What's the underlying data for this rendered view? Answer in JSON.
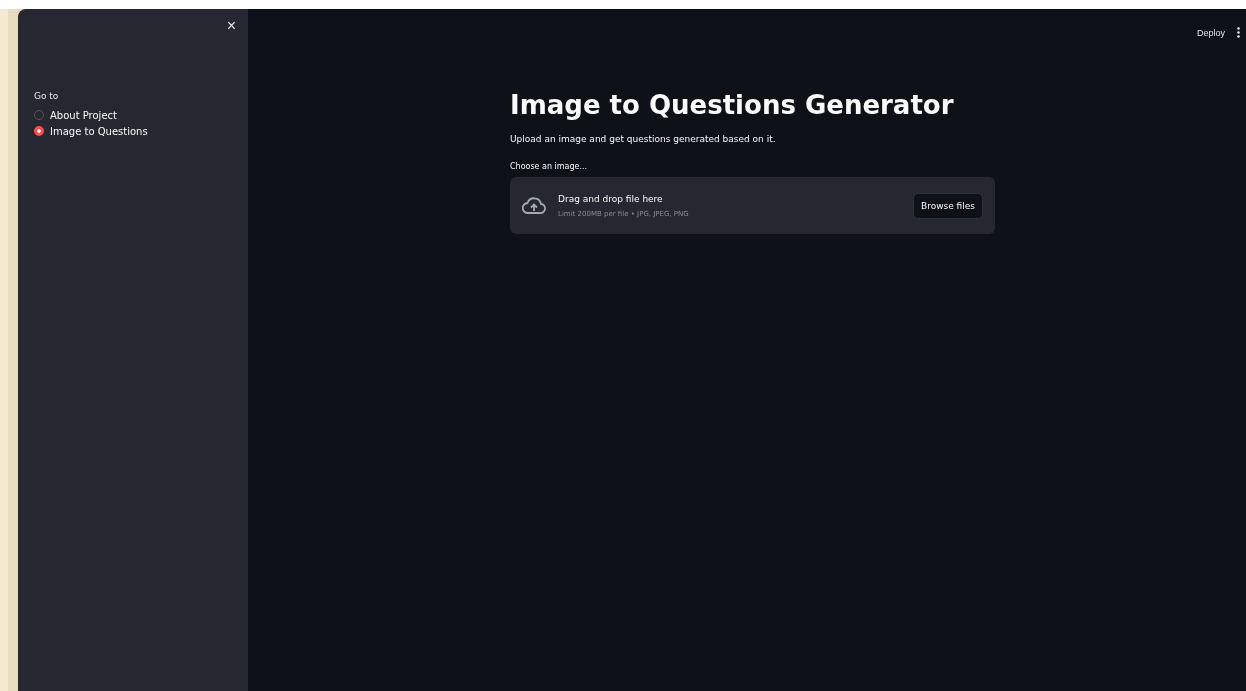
{
  "sidebar": {
    "close": "×",
    "radio_label": "Go to",
    "options": [
      {
        "label": "About Project",
        "selected": false
      },
      {
        "label": "Image to Questions",
        "selected": true
      }
    ]
  },
  "header": {
    "deploy": "Deploy"
  },
  "main": {
    "title": "Image to Questions Generator",
    "description": "Upload an image and get questions generated based on it.",
    "uploader": {
      "label": "Choose an image...",
      "drop_text": "Drag and drop file here",
      "limit": "Limit 200MB per file • JPG, JPEG, PNG",
      "button": "Browse files"
    }
  }
}
